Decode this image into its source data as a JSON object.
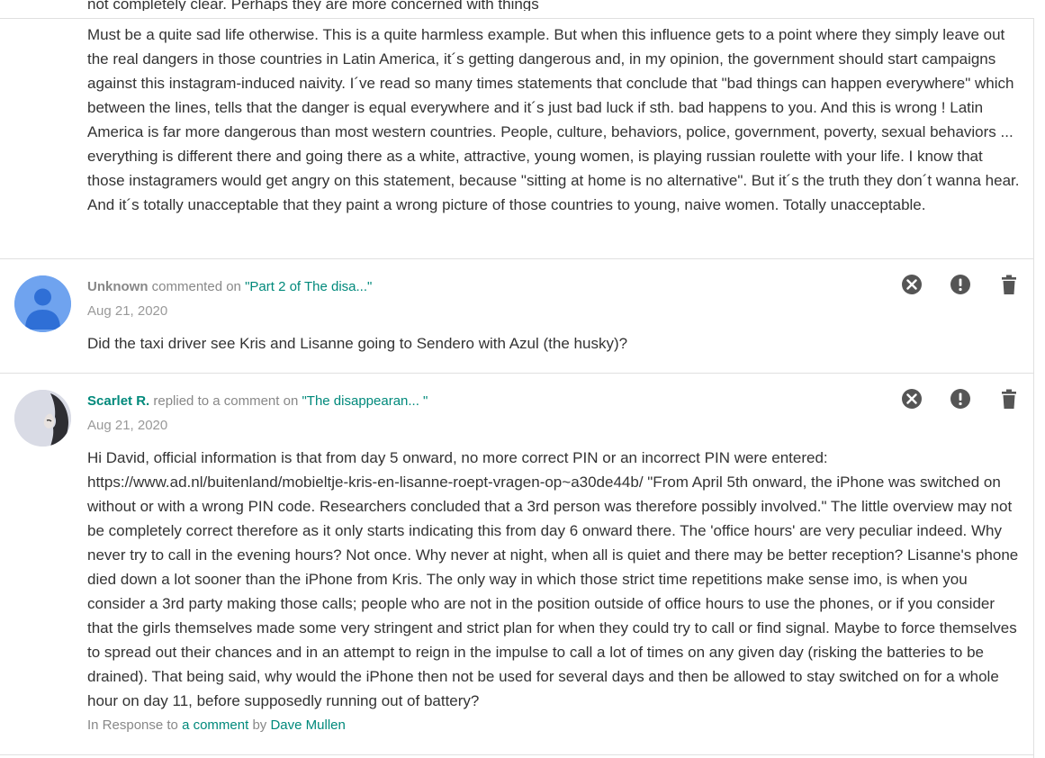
{
  "partial_top_line": "not completely clear. Perhaps they are more concerned with things",
  "comment0": {
    "text": "Must be a quite sad life otherwise. This is a quite harmless example. But when this influence gets to a point where they simply leave out the real dangers in those countries in Latin America, it´s getting dangerous and, in my opinion, the government should start campaigns against this instagram-induced naivity. I´ve read so many times statements that conclude that \"bad things can happen everywhere\" which between the lines, tells that the danger is equal everywhere and it´s just bad luck if sth. bad happens to you. And this is wrong ! Latin America is far more dangerous than most western countries. People, culture, behaviors, police, government, poverty, sexual behaviors ... everything is different there and going there as a white, attractive, young women, is playing russian roulette with your life. I know that those instagramers would get angry on this statement, because \"sitting at home is no alternative\". But it´s the truth they don´t wanna hear. And it´s totally unacceptable that they paint a wrong picture of those countries to young, naive women. Totally unacceptable."
  },
  "comment1": {
    "author": "Unknown",
    "action": " commented on ",
    "post": "\"Part 2 of The disa...\"",
    "date": "Aug 21, 2020",
    "text": "Did the taxi driver see Kris and Lisanne going to Sendero with Azul (the husky)?"
  },
  "comment2": {
    "author": "Scarlet R.",
    "action": " replied to a comment on ",
    "post": "\"The disappearan...  \"",
    "date": "Aug 21, 2020",
    "text": "Hi David, official information is that from day 5 onward, no more correct PIN or an incorrect PIN were entered: https://www.ad.nl/buitenland/mobieltje-kris-en-lisanne-roept-vragen-op~a30de44b/ \"From April 5th onward, the iPhone was switched on without or with a wrong PIN code. Researchers concluded that a 3rd person was therefore possibly involved.\" The little overview may not be completely correct therefore as it only starts indicating this from day 6 onward there. The 'office hours' are very peculiar indeed. Why never try to call in the evening hours? Not once. Why never at night, when all is quiet and there may be better reception? Lisanne's phone died down a lot sooner than the iPhone from Kris. The only way in which those strict time repetitions make sense imo, is when you consider a 3rd party making those calls; people who are not in the position outside of office hours to use the phones, or if you consider that the girls themselves made some very stringent and strict plan for when they could try to call or find signal. Maybe to force themselves to spread out their chances and in an attempt to reign in the impulse to call a lot of times on any given day (risking the batteries to be drained). That being said, why would the iPhone then not be used for several days and then be allowed to stay switched on for a whole hour on day 11, before supposedly running out of battery?",
    "response_prefix": "In Response to ",
    "response_link": "a comment",
    "response_by": " by ",
    "response_author": "Dave Mullen"
  },
  "icons": [
    "remove-icon",
    "spam-icon",
    "delete-icon"
  ],
  "colors": {
    "link": "#00897b",
    "icon": "#555555",
    "avatar_default": "#6fa3ef",
    "divider": "#e0e0e0"
  }
}
